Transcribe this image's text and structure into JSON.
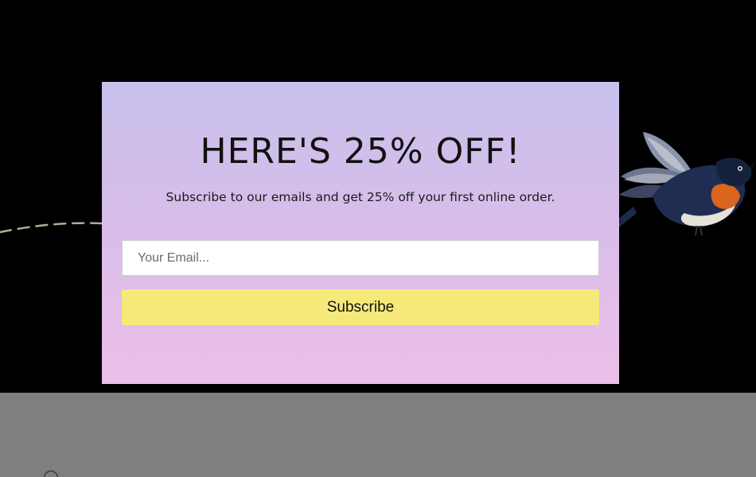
{
  "popup": {
    "title": "HERE'S 25% OFF!",
    "subtitle": "Subscribe to our emails and get 25% off your first online order.",
    "email_placeholder": "Your Email...",
    "email_value": "",
    "subscribe_label": "Subscribe",
    "gradient_top": "#c8c1ec",
    "gradient_bottom": "#ecbfe8",
    "button_color": "#f5e97a"
  },
  "background": {
    "hero_color": "#000000",
    "overlay_color": "#7f7f7f",
    "illustration": "swallow-bird-icon"
  }
}
